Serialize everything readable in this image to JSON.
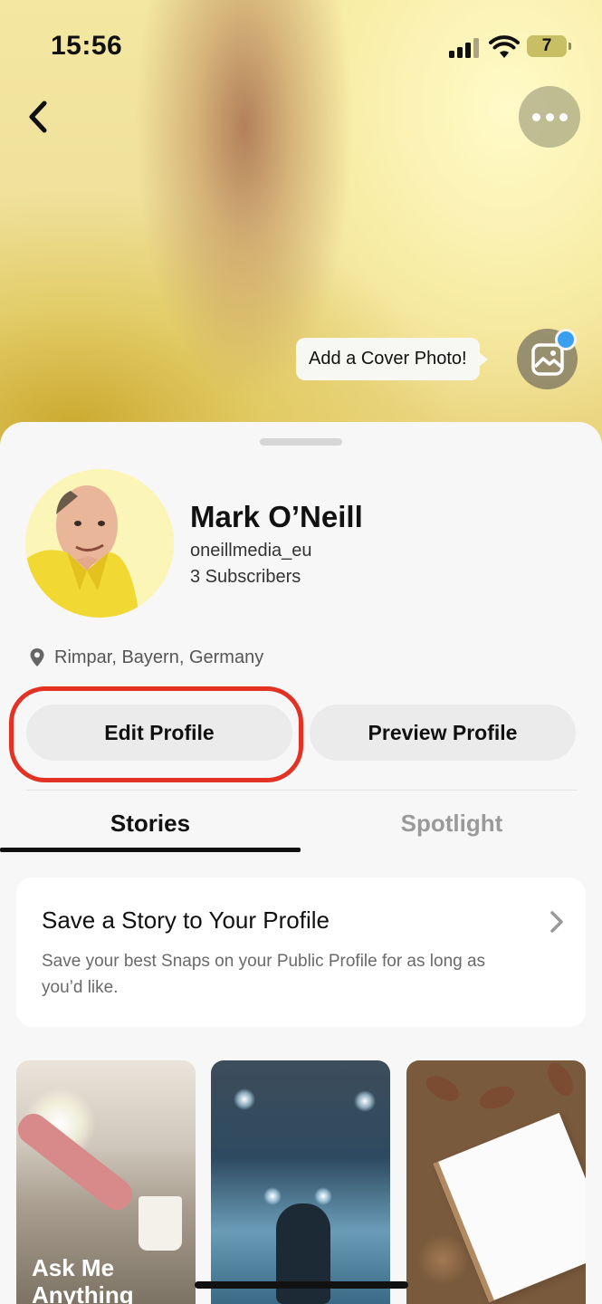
{
  "status_bar": {
    "time": "15:56",
    "battery_level": "7"
  },
  "header": {
    "back_icon": "chevron-left-icon",
    "more_icon": "ellipsis-icon",
    "cover_tip": "Add a Cover Photo!",
    "cover_photo_icon": "image-edit-icon",
    "notification_dot_color": "#3a9ff0"
  },
  "profile": {
    "name": "Mark O’Neill",
    "handle": "oneillmedia_eu",
    "subscribers": "3 Subscribers",
    "location": "Rimpar, Bayern, Germany",
    "location_icon": "map-pin-icon"
  },
  "actions": {
    "edit_label": "Edit Profile",
    "preview_label": "Preview Profile",
    "highlight_color": "#e33124"
  },
  "tabs": [
    {
      "label": "Stories",
      "active": true
    },
    {
      "label": "Spotlight",
      "active": false
    }
  ],
  "save_card": {
    "title": "Save a Story to Your Profile",
    "description": "Save your best Snaps on your Public Profile for as long as you’d like.",
    "chevron_icon": "chevron-right-icon"
  },
  "story_tiles": [
    {
      "label": "Ask Me Anything"
    },
    {
      "label": ""
    },
    {
      "label": ""
    }
  ]
}
